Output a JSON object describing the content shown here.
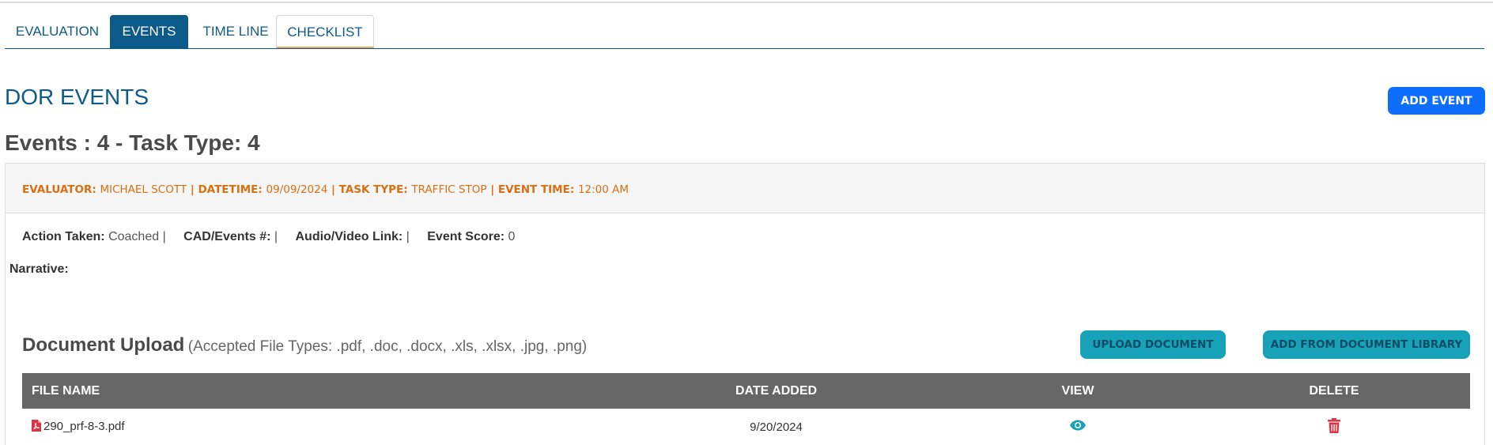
{
  "tabs": [
    {
      "label": "EVALUATION"
    },
    {
      "label": "EVENTS"
    },
    {
      "label": "TIME LINE"
    },
    {
      "label": "CHECKLIST"
    }
  ],
  "header": {
    "title": "DOR EVENTS",
    "add_event_label": "ADD EVENT",
    "counts": "Events : 4 - Task Type: 4"
  },
  "event": {
    "evaluator_label": "EVALUATOR:",
    "evaluator": "MICHAEL SCOTT",
    "datetime_label": "DATETIME:",
    "datetime": "09/09/2024",
    "task_type_label": "TASK TYPE:",
    "task_type": "TRAFFIC STOP",
    "event_time_label": "EVENT TIME:",
    "event_time": "12:00 AM",
    "separator": "|",
    "action_taken_label": "Action Taken:",
    "action_taken": "Coached",
    "cad_label": "CAD/Events #:",
    "cad": "",
    "av_label": "Audio/Video Link:",
    "av": "",
    "score_label": "Event Score:",
    "score": "0",
    "narrative_label": "Narrative:"
  },
  "documents": {
    "title": "Document Upload",
    "accepted": "(Accepted File Types: .pdf, .doc, .docx, .xls, .xlsx, .jpg, .png)",
    "upload_label": "UPLOAD DOCUMENT",
    "library_label": "ADD FROM DOCUMENT LIBRARY",
    "columns": {
      "file_name": "FILE NAME",
      "date_added": "DATE ADDED",
      "view": "VIEW",
      "delete": "DELETE"
    },
    "rows": [
      {
        "file_name": "290_prf-8-3.pdf",
        "date_added": "9/20/2024",
        "file_icon": "file-pdf-icon",
        "view_icon": "eye-icon",
        "delete_icon": "trash-icon"
      }
    ]
  },
  "colors": {
    "primary_blue": "#0b5a8a",
    "button_blue": "#0d6efd",
    "orange": "#d87012",
    "teal": "#17a2b8",
    "table_header": "#666666",
    "delete_red": "#dc3545"
  }
}
